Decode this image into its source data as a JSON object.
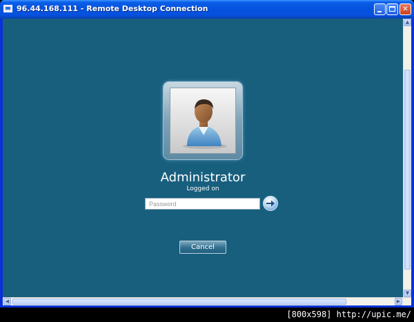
{
  "window": {
    "title": "96.44.168.111 - Remote Desktop Connection"
  },
  "login": {
    "username": "Administrator",
    "status": "Logged on",
    "password_placeholder": "Password",
    "cancel_label": "Cancel"
  },
  "footer": {
    "watermark": "[800x598] http://upic.me/"
  },
  "colors": {
    "background": "#185f7e",
    "titlebar": "#0553de",
    "button": "#2f6e8e"
  }
}
